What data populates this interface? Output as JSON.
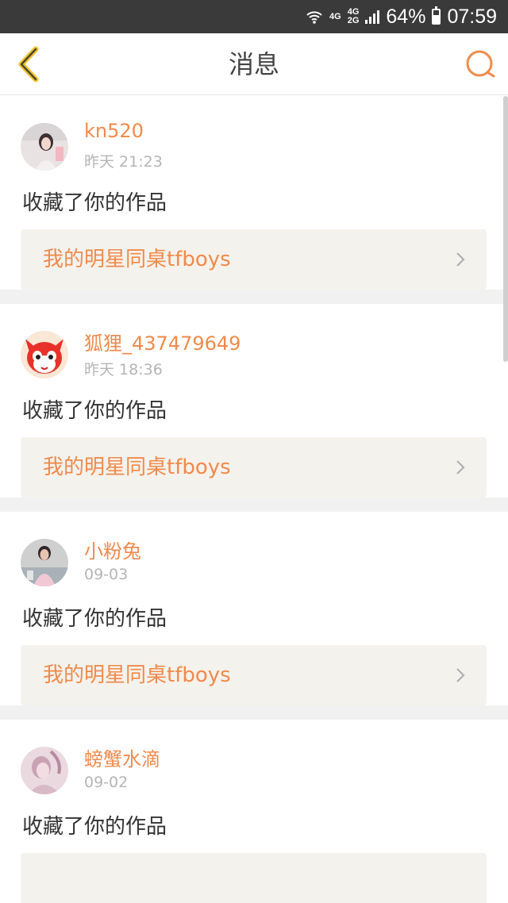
{
  "status_bar": {
    "network_top": "4G",
    "network_mid": "4G",
    "network_bottom": "2G",
    "battery": "64%",
    "time": "07:59"
  },
  "nav": {
    "title": "消息"
  },
  "messages": [
    {
      "username": "kn520",
      "time": "昨天 21:23",
      "action": "收藏了你的作品",
      "work_title": "我的明星同桌tfboys",
      "avatar_icon": "photo-avatar"
    },
    {
      "username": "狐狸_437479649",
      "time": "昨天 18:36",
      "action": "收藏了你的作品",
      "work_title": "我的明星同桌tfboys",
      "avatar_icon": "fox-avatar"
    },
    {
      "username": "小粉兔",
      "time": "09-03",
      "action": "收藏了你的作品",
      "work_title": "我的明星同桌tfboys",
      "avatar_icon": "photo-avatar"
    },
    {
      "username": "螃蟹水滴",
      "time": "09-02",
      "action": "收藏了你的作品",
      "work_title": "",
      "avatar_icon": "photo-avatar"
    }
  ],
  "colors": {
    "accent": "#f08a4b",
    "back_arrow": "#f2c230",
    "card_bg": "#f4f2ec",
    "status_bar": "#3a3a3a"
  }
}
